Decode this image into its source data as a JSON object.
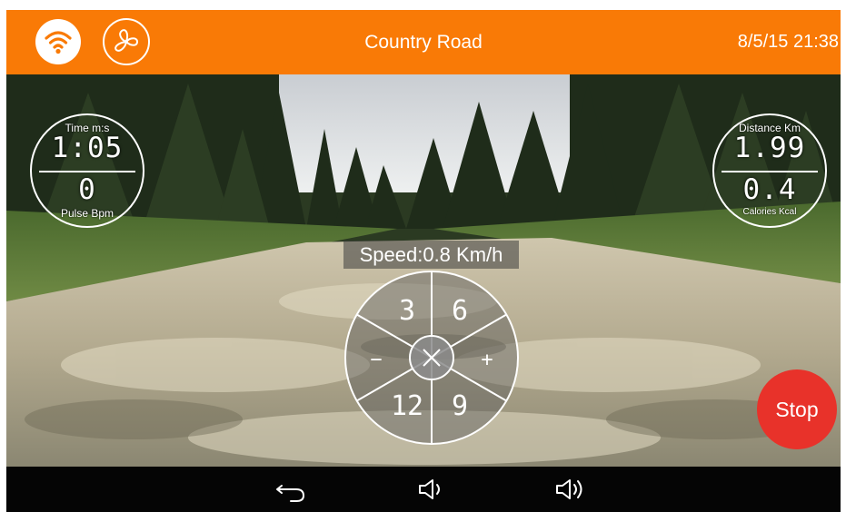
{
  "topbar": {
    "title": "Country Road",
    "datetime": "8/5/15 21:38",
    "wifi_icon": "wifi-icon",
    "fan_icon": "fan-icon",
    "accent_color": "#f97a06"
  },
  "gauges": {
    "left": {
      "top_label": "Time m:s",
      "top_value": "1:05",
      "bottom_value": "0",
      "bottom_label": "Pulse Bpm"
    },
    "right": {
      "top_label": "Distance Km",
      "top_value": "1.99",
      "bottom_value": "0.4",
      "bottom_label": "Calories Kcal"
    }
  },
  "speed": {
    "text": "Speed:0.8 Km/h"
  },
  "dial": {
    "top_left": "3",
    "top_right": "6",
    "left": "−",
    "right": "+",
    "bottom_left": "12",
    "bottom_right": "9",
    "center_icon": "close-icon"
  },
  "stop_button": {
    "label": "Stop",
    "color": "#e8322a"
  },
  "navbar": {
    "back_icon": "back-arrow-icon",
    "volume_down_icon": "volume-down-icon",
    "volume_up_icon": "volume-up-icon"
  }
}
